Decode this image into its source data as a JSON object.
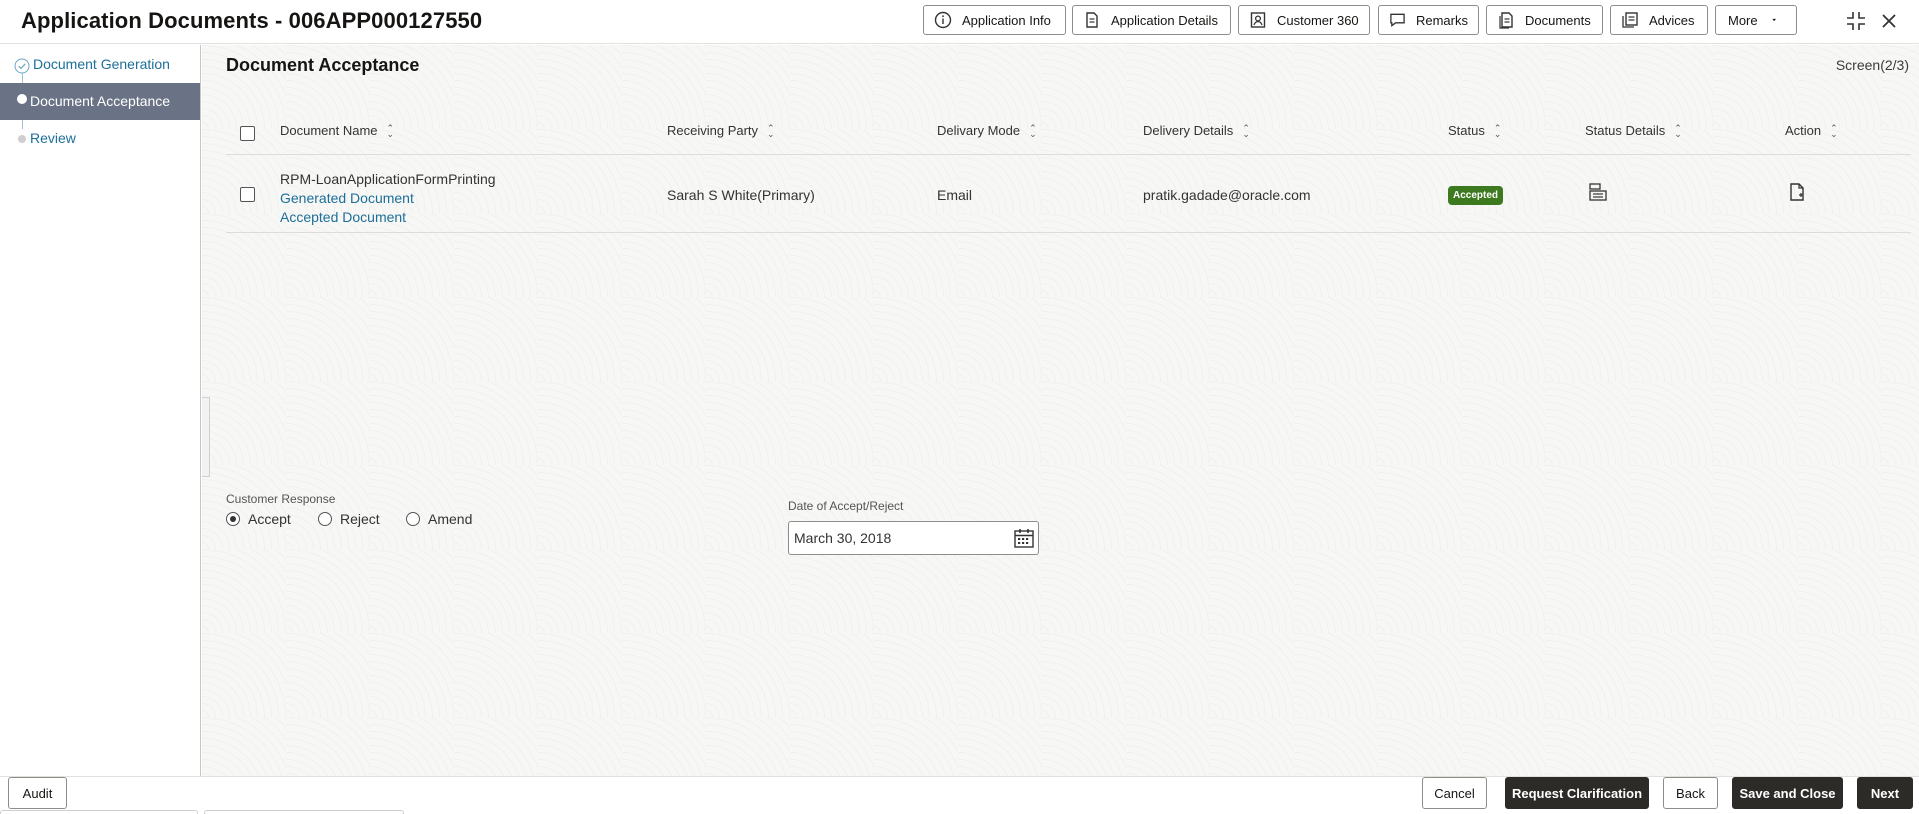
{
  "header": {
    "title": "Application Documents - 006APP000127550",
    "buttons": [
      {
        "label": "Application Info",
        "icon": "info-icon"
      },
      {
        "label": "Application Details",
        "icon": "document-icon"
      },
      {
        "label": "Customer 360",
        "icon": "customer-card-icon"
      },
      {
        "label": "Remarks",
        "icon": "chat-bubble-icon"
      },
      {
        "label": "Documents",
        "icon": "documents-icon"
      },
      {
        "label": "Advices",
        "icon": "advices-icon"
      },
      {
        "label": "More",
        "icon": "caret-down-icon"
      }
    ]
  },
  "sidebar": {
    "steps": [
      {
        "label": "Document Generation",
        "state": "completed"
      },
      {
        "label": "Document Acceptance",
        "state": "active"
      },
      {
        "label": "Review",
        "state": "pending"
      }
    ]
  },
  "main": {
    "title": "Document Acceptance",
    "screen": "Screen(2/3)",
    "table": {
      "columns": [
        "Document Name",
        "Receiving Party",
        "Delivary Mode",
        "Delivery Details",
        "Status",
        "Status Details",
        "Action"
      ],
      "rows": [
        {
          "document_name": "RPM-LoanApplicationFormPrinting",
          "generated_link": "Generated Document",
          "accepted_link": "Accepted Document",
          "receiving_party": "Sarah S White(Primary)",
          "delivery_mode": "Email",
          "delivery_details": "pratik.gadade@oracle.com",
          "status": "Accepted"
        }
      ]
    },
    "customer_response": {
      "label": "Customer Response",
      "options": [
        "Accept",
        "Reject",
        "Amend"
      ],
      "selected": "Accept"
    },
    "date_field": {
      "label": "Date of Accept/Reject",
      "value": "March 30, 2018"
    }
  },
  "footer": {
    "audit": "Audit",
    "cancel": "Cancel",
    "request_clarification": "Request Clarification",
    "back": "Back",
    "save_and_close": "Save and Close",
    "next": "Next"
  },
  "colors": {
    "accent_link": "#1d6f99",
    "active_step": "#6a7386",
    "status_accepted": "#3d7a1f",
    "primary_button": "#2c2b28"
  }
}
